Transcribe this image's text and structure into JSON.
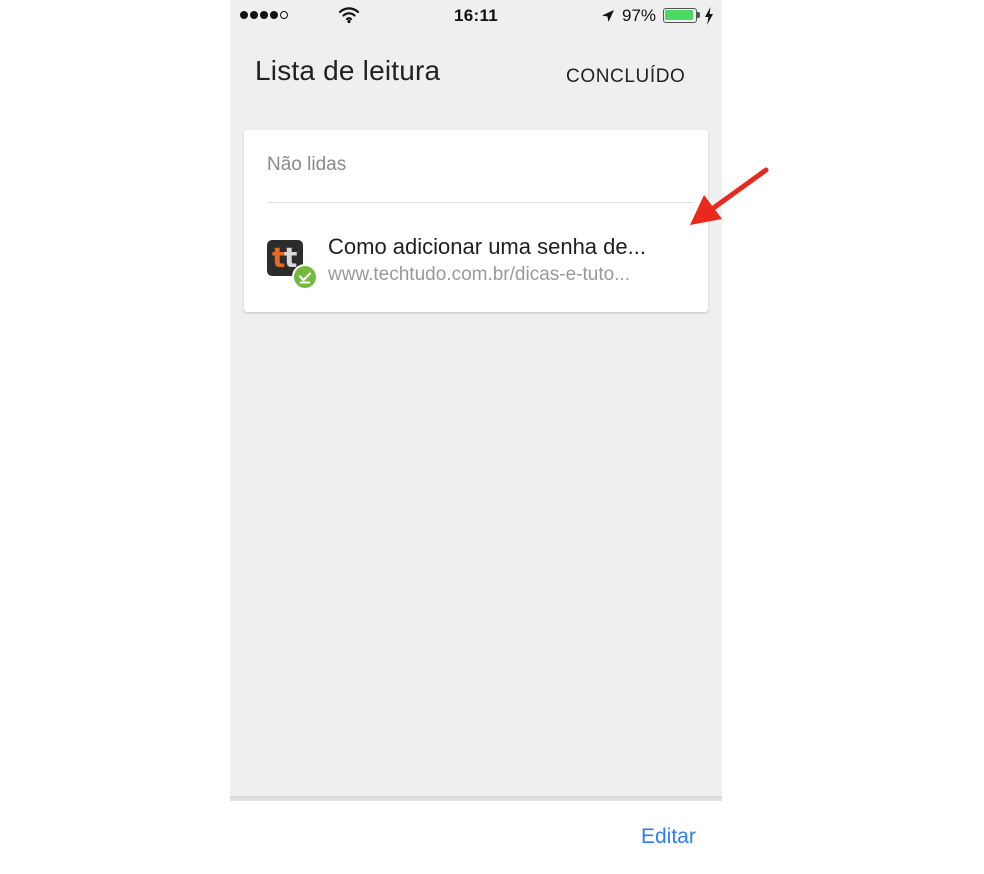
{
  "status_bar": {
    "signal_bars": 5,
    "signal_filled": 4,
    "time": "16:11",
    "battery_percent_label": "97%",
    "battery_level": 0.97,
    "icons": [
      "signal-dots-icon",
      "wifi-icon",
      "location-arrow-icon",
      "battery-icon",
      "charging-bolt-icon"
    ]
  },
  "header": {
    "title": "Lista de leitura",
    "done_label": "CONCLUÍDO"
  },
  "reading_list": {
    "section_label": "Não lidas",
    "items": [
      {
        "title": "Como adicionar uma senha de...",
        "url": "www.techtudo.com.br/dicas-e-tuto...",
        "favicon_text": [
          "t",
          "t"
        ],
        "badge": "offline-check-icon"
      }
    ]
  },
  "footer": {
    "edit_label": "Editar"
  },
  "colors": {
    "background": "#efefef",
    "card": "#ffffff",
    "accent_blue": "#2f7df6",
    "badge_green": "#74b83d",
    "annotation_red": "#e8291c",
    "favicon_orange": "#e46b1f",
    "battery_green": "#4cd964"
  }
}
